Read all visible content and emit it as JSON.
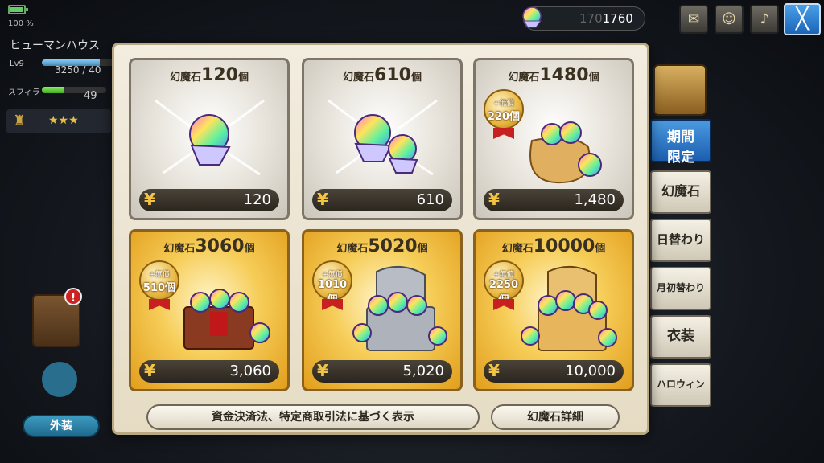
{
  "status": {
    "battery": "100 %",
    "battery_level": 1.0
  },
  "player": {
    "name": "ヒューマンハウス",
    "lv_label": "Lv9",
    "exp_text": "3250 / 40",
    "exp_fraction": 0.8,
    "sp_label": "スフィラ",
    "sp_value": "49",
    "sp_fraction": 0.35,
    "rank_stars": "★★★"
  },
  "currency": {
    "value": "1760",
    "ghost": "170"
  },
  "header_buttons": [
    "mail-icon",
    "friends-icon",
    "horn-icon"
  ],
  "close_label": "╳",
  "side_tabs": [
    {
      "label": "期間\n限定",
      "line1": "期間",
      "line2": "限定",
      "active": true
    },
    {
      "label": "幻魔石",
      "active": false
    },
    {
      "label": "日替わり",
      "active": false
    },
    {
      "label": "月初替わり",
      "active": false
    },
    {
      "label": "衣装",
      "active": false
    },
    {
      "label": "ハロウィン",
      "active": false
    }
  ],
  "costume_label": "外装",
  "alert_mark": "!",
  "shop": {
    "items": [
      {
        "prefix": "幻魔石",
        "amount": "120",
        "unit": "個",
        "price": "120",
        "yen": "¥",
        "tier": "silver"
      },
      {
        "prefix": "幻魔石",
        "amount": "610",
        "unit": "個",
        "price": "610",
        "yen": "¥",
        "tier": "silver"
      },
      {
        "prefix": "幻魔石",
        "amount": "1480",
        "unit": "個",
        "price": "1,480",
        "yen": "¥",
        "tier": "silver",
        "bonus_top": "+無償",
        "bonus_val": "220個"
      },
      {
        "prefix": "幻魔石",
        "amount": "3060",
        "unit": "個",
        "price": "3,060",
        "yen": "¥",
        "tier": "gold",
        "bonus_top": "+無償",
        "bonus_val": "510個"
      },
      {
        "prefix": "幻魔石",
        "amount": "5020",
        "unit": "個",
        "price": "5,020",
        "yen": "¥",
        "tier": "gold",
        "bonus_top": "+無償",
        "bonus_val": "1010個"
      },
      {
        "prefix": "幻魔石",
        "amount": "10000",
        "unit": "個",
        "price": "10,000",
        "yen": "¥",
        "tier": "gold",
        "bonus_top": "+無償",
        "bonus_val": "2250個"
      }
    ],
    "legal_button": "資金決済法、特定商取引法に基づく表示",
    "details_button": "幻魔石詳細"
  }
}
